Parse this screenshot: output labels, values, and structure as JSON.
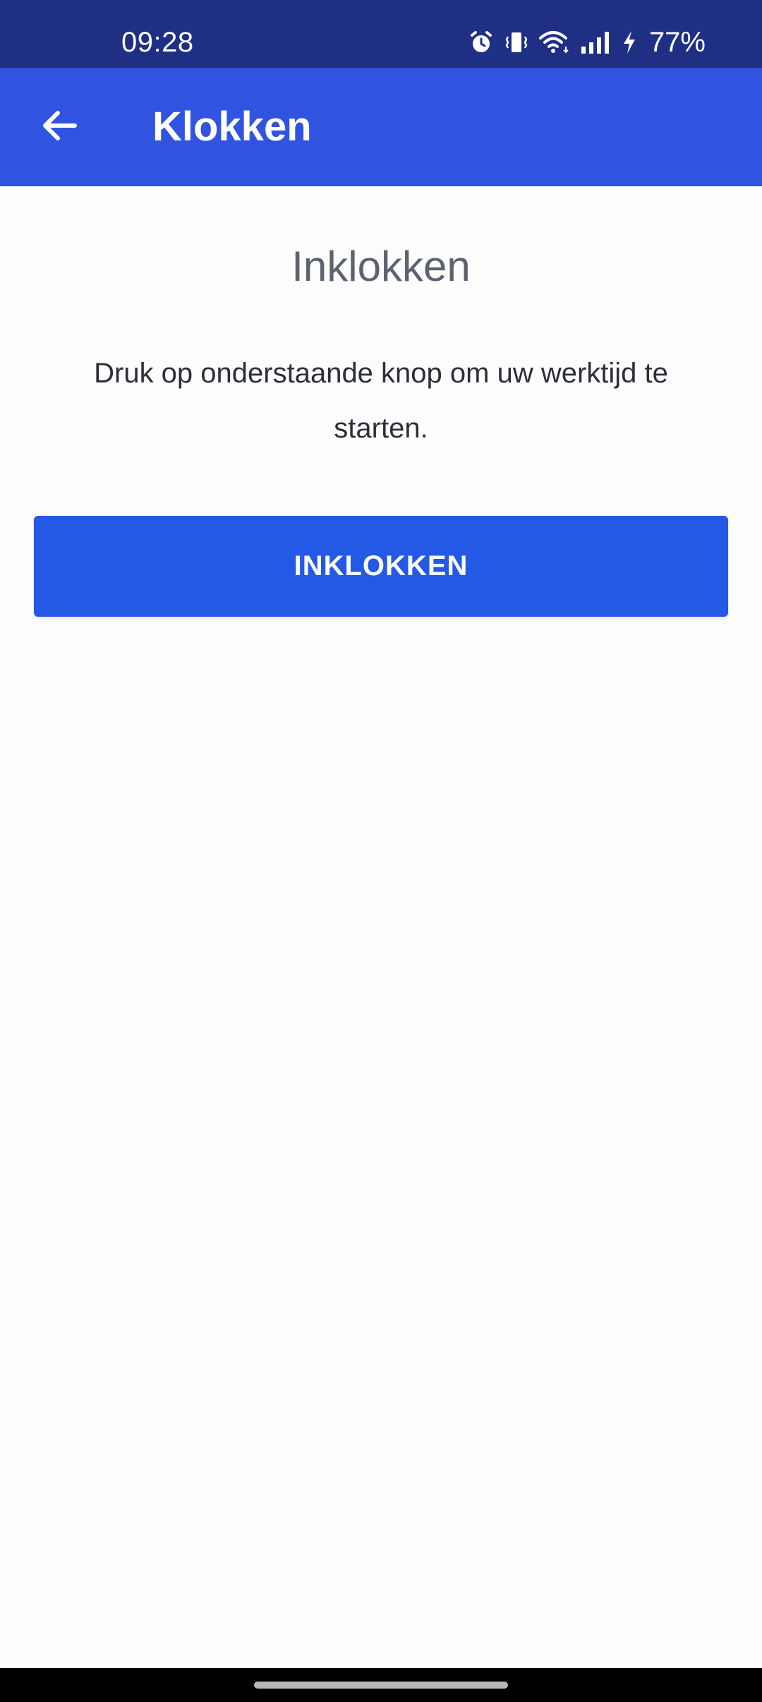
{
  "status_bar": {
    "time": "09:28",
    "battery": "77%",
    "icons": [
      "alarm-icon",
      "vibrate-icon",
      "wifi-icon",
      "signal-icon",
      "charging-icon"
    ]
  },
  "app_bar": {
    "title": "Klokken",
    "back_icon": "arrow-left-icon"
  },
  "main": {
    "heading": "Inklokken",
    "instruction": "Druk op onderstaande knop om uw werktijd te starten.",
    "button_label": "INKLOKKEN"
  },
  "colors": {
    "status_bar": "#1e2f84",
    "app_bar": "#3054e0",
    "primary_button": "#2459e6",
    "background": "#fdfdfd",
    "heading_text": "#5b6270",
    "body_text": "#2b2f38"
  }
}
